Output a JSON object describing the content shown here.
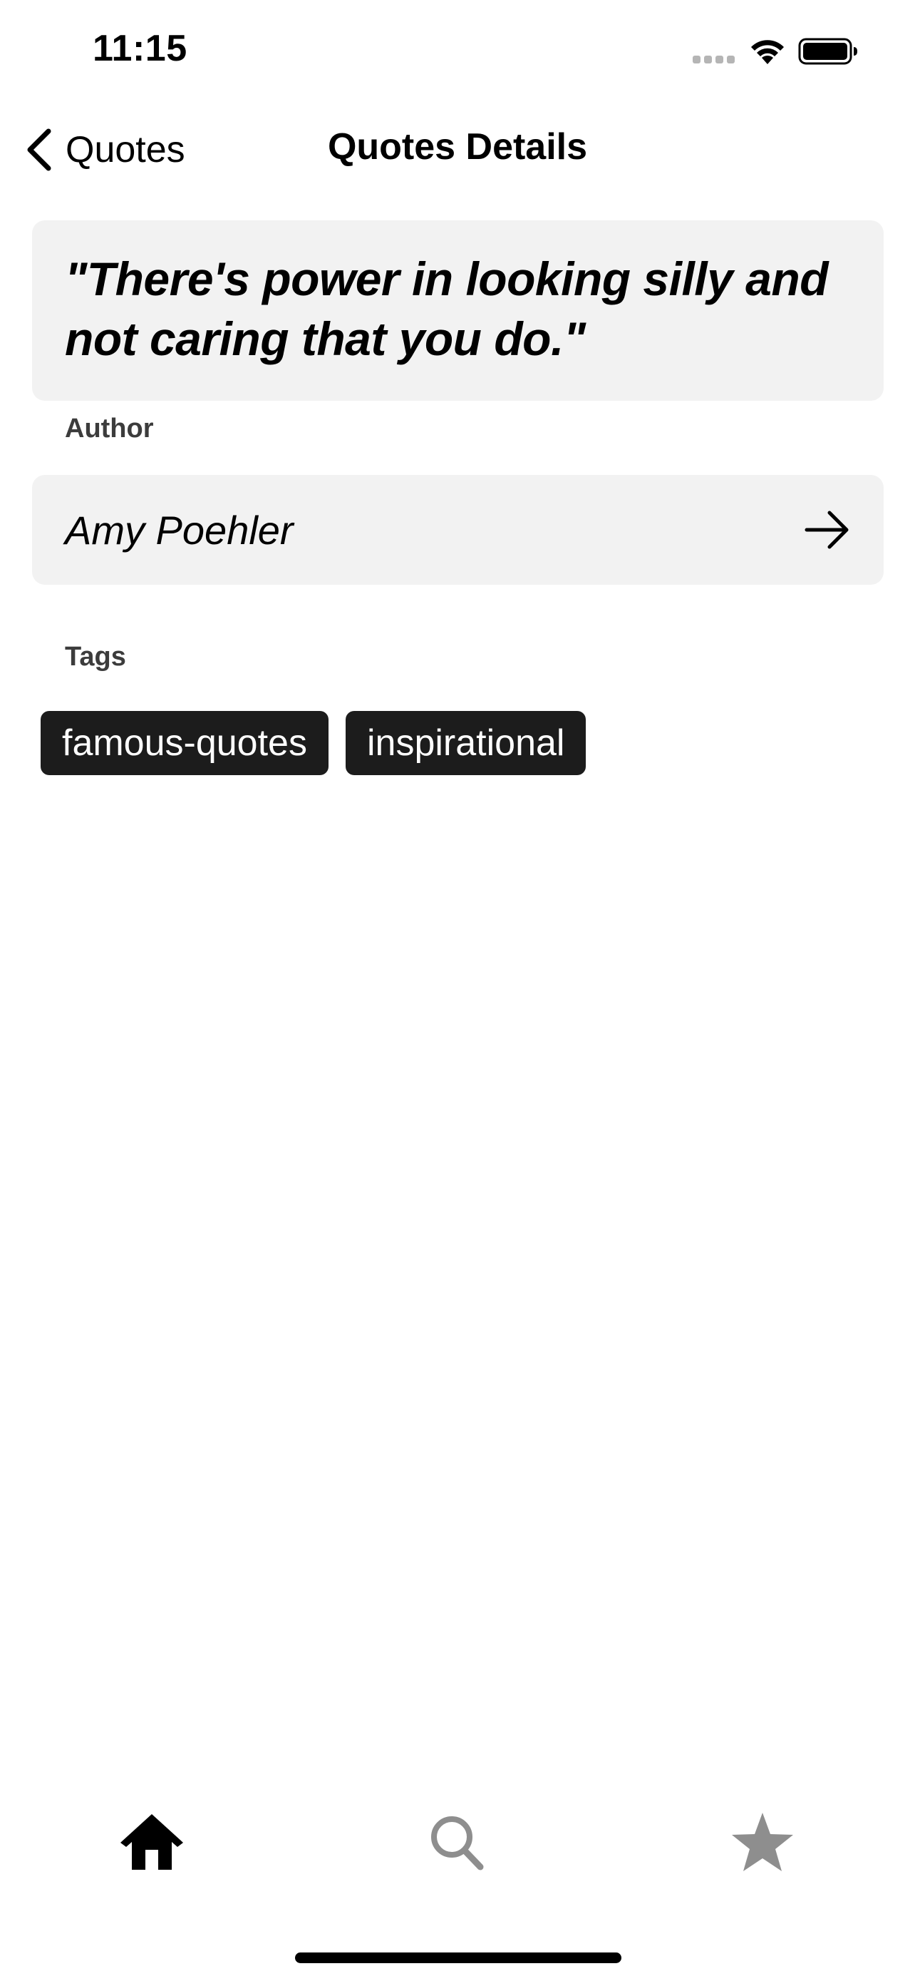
{
  "status_bar": {
    "time": "11:15"
  },
  "nav": {
    "back_label": "Quotes",
    "title": "Quotes Details"
  },
  "quote": {
    "text_line1": "\"There's power in looking silly and",
    "text_line2": "not caring that you do.\""
  },
  "author": {
    "section_label": "Author",
    "name": "Amy Poehler"
  },
  "tags": {
    "section_label": "Tags",
    "items": [
      "famous-quotes",
      "inspirational"
    ]
  },
  "tab_bar": {
    "tabs": [
      {
        "icon": "home-icon",
        "active": true
      },
      {
        "icon": "search-icon",
        "active": false
      },
      {
        "icon": "star-icon",
        "active": false
      }
    ]
  },
  "colors": {
    "card_background": "#f2f2f2",
    "tag_background": "#1c1c1c",
    "tab_inactive": "#8e8e8e"
  }
}
